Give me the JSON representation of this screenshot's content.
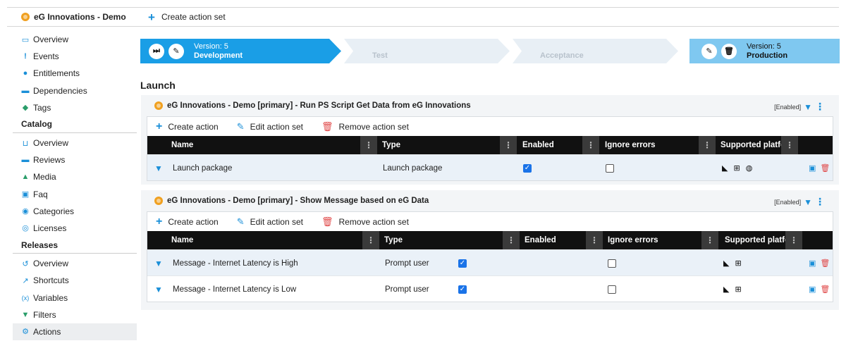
{
  "header": {
    "app_title": "eG Innovations - Demo",
    "create_action_set": "Create action set"
  },
  "sidebar": {
    "items_top": [
      {
        "label": "Overview",
        "icon": "overview-icon"
      },
      {
        "label": "Events",
        "icon": "exclamation-icon"
      },
      {
        "label": "Entitlements",
        "icon": "user-icon"
      },
      {
        "label": "Dependencies",
        "icon": "dependencies-icon"
      },
      {
        "label": "Tags",
        "icon": "tag-icon"
      }
    ],
    "catalog_title": "Catalog",
    "catalog_items": [
      {
        "label": "Overview",
        "icon": "basket-icon"
      },
      {
        "label": "Reviews",
        "icon": "chat-icon"
      },
      {
        "label": "Media",
        "icon": "image-icon"
      },
      {
        "label": "Faq",
        "icon": "faq-icon"
      },
      {
        "label": "Categories",
        "icon": "categories-icon"
      },
      {
        "label": "Licenses",
        "icon": "license-icon"
      }
    ],
    "releases_title": "Releases",
    "releases_items": [
      {
        "label": "Overview",
        "icon": "overview-icon"
      },
      {
        "label": "Shortcuts",
        "icon": "shortcut-icon"
      },
      {
        "label": "Variables",
        "icon": "variables-icon"
      },
      {
        "label": "Filters",
        "icon": "filter-icon"
      },
      {
        "label": "Actions",
        "icon": "actions-icon"
      }
    ]
  },
  "pipeline": {
    "development": {
      "version": "Version: 5",
      "name": "Development"
    },
    "test": {
      "name": "Test"
    },
    "acceptance": {
      "name": "Acceptance"
    },
    "production": {
      "version": "Version: 5",
      "name": "Production"
    }
  },
  "section_title": "Launch",
  "panels": [
    {
      "title": "eG Innovations - Demo [primary] - Run PS Script Get Data from eG Innovations",
      "status": "[Enabled]",
      "toolbar": {
        "create": "Create action",
        "edit": "Edit action set",
        "remove": "Remove action set"
      },
      "columns": {
        "name": "Name",
        "type": "Type",
        "enabled": "Enabled",
        "ignore": "Ignore errors",
        "platforms": "Supported platfo"
      },
      "rows": [
        {
          "name": "Launch package",
          "type": "Launch package",
          "enabled": true,
          "ignore_errors": false
        }
      ]
    },
    {
      "title": "eG Innovations - Demo [primary] - Show Message based on eG Data",
      "status": "[Enabled]",
      "toolbar": {
        "create": "Create action",
        "edit": "Edit action set",
        "remove": "Remove action set"
      },
      "columns": {
        "name": "Name",
        "type": "Type",
        "enabled": "Enabled",
        "ignore": "Ignore errors",
        "platforms": "Supported platfo"
      },
      "rows": [
        {
          "name": "Message - Internet Latency is High",
          "type": "Prompt user",
          "enabled": true,
          "ignore_errors": false
        },
        {
          "name": "Message - Internet Latency is Low",
          "type": "Prompt user",
          "enabled": true,
          "ignore_errors": false
        }
      ]
    }
  ],
  "colors": {
    "accent": "#1a8fd8",
    "stage_active": "#1a9ee6",
    "stage_light": "#7fc8f0",
    "stage_inactive": "#e8eff5",
    "delete": "#e04848"
  }
}
